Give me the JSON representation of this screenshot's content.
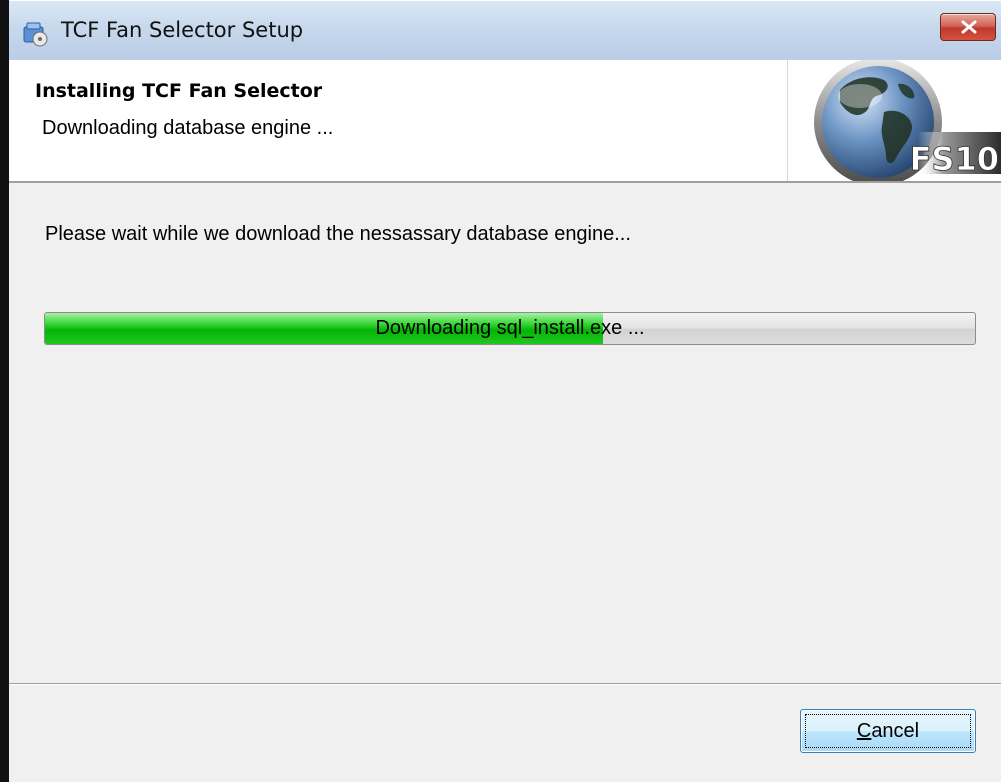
{
  "window": {
    "title": "TCF Fan Selector Setup",
    "title_icon": "setup-installer-icon",
    "close_icon": "close-icon"
  },
  "header": {
    "title": "Installing TCF Fan Selector",
    "subtitle": "Downloading database engine ...",
    "logo": {
      "icon": "globe-icon",
      "text": "FS10"
    }
  },
  "content": {
    "message": "Please wait while we download the nessassary database engine...",
    "progress": {
      "label": "Downloading sql_install.exe ...",
      "fraction": 0.6,
      "fill_color": "#06b406"
    }
  },
  "footer": {
    "cancel_label": "Cancel"
  }
}
